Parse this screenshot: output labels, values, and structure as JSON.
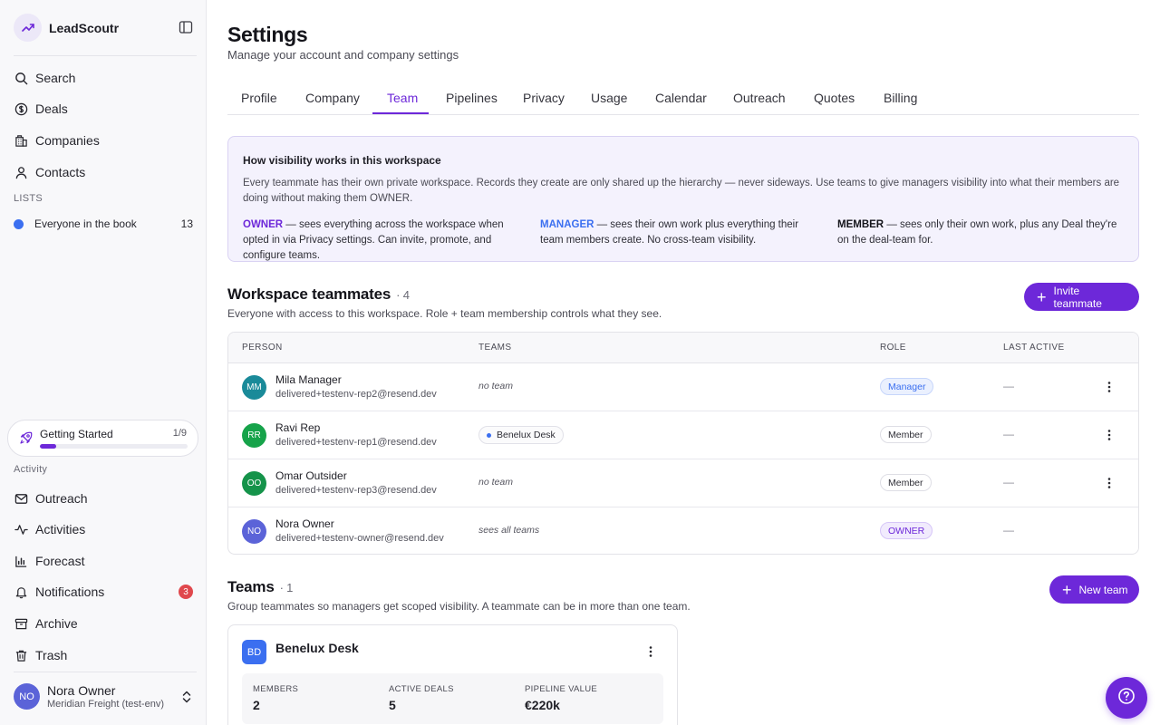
{
  "sidebar": {
    "brand": "LeadScoutr",
    "nav": [
      {
        "label": "Search",
        "icon": "search-icon"
      },
      {
        "label": "Deals",
        "icon": "dollar-icon"
      },
      {
        "label": "Companies",
        "icon": "building-icon"
      },
      {
        "label": "Contacts",
        "icon": "user-icon"
      }
    ],
    "lists_label": "LISTS",
    "lists": [
      {
        "label": "Everyone in the book",
        "count": "13",
        "color": "#3b6ff0"
      }
    ],
    "getting_started": {
      "label": "Getting Started",
      "progress_text": "1/9",
      "progress": 0.11
    },
    "activity_label": "Activity",
    "activity": [
      {
        "label": "Outreach",
        "icon": "mail-icon"
      },
      {
        "label": "Activities",
        "icon": "activity-icon"
      },
      {
        "label": "Forecast",
        "icon": "bar-chart-icon"
      },
      {
        "label": "Notifications",
        "icon": "bell-icon",
        "badge": "3"
      },
      {
        "label": "Archive",
        "icon": "archive-icon"
      },
      {
        "label": "Trash",
        "icon": "trash-icon"
      }
    ],
    "user": {
      "initials": "NO",
      "name": "Nora Owner",
      "org": "Meridian Freight (test-env)"
    }
  },
  "header": {
    "title": "Settings",
    "subtitle": "Manage your account and company settings"
  },
  "tabs": [
    "Profile",
    "Company",
    "Team",
    "Pipelines",
    "Privacy",
    "Usage",
    "Calendar",
    "Outreach",
    "Quotes",
    "Billing"
  ],
  "active_tab": "Team",
  "info": {
    "title": "How visibility works in this workspace",
    "body": "Every teammate has their own private workspace. Records they create are only shared up the hierarchy — never sideways. Use teams to give managers visibility into what their members are doing without making them OWNER.",
    "roles": [
      {
        "key": "OWNER",
        "text": " — sees everything across the workspace when opted in via Privacy settings. Can invite, promote, and configure teams."
      },
      {
        "key": "MANAGER",
        "text": " — sees their own work plus everything their team members create. No cross-team visibility."
      },
      {
        "key": "MEMBER",
        "text": " — sees only their own work, plus any Deal they're on the deal-team for."
      }
    ]
  },
  "teammates": {
    "title": "Workspace teammates",
    "count": "· 4",
    "subtitle": "Everyone with access to this workspace. Role + team membership controls what they see.",
    "invite_label": "Invite teammate",
    "columns": [
      "PERSON",
      "TEAMS",
      "ROLE",
      "LAST ACTIVE"
    ],
    "rows": [
      {
        "initials": "MM",
        "avatar_color": "#1a8a99",
        "name": "Mila Manager",
        "email": "delivered+testenv-rep2@resend.dev",
        "team": "no team",
        "team_type": "none",
        "role": "Manager",
        "role_type": "manager",
        "last_active": "—"
      },
      {
        "initials": "RR",
        "avatar_color": "#16a34a",
        "name": "Ravi Rep",
        "email": "delivered+testenv-rep1@resend.dev",
        "team": "Benelux Desk",
        "team_type": "chip",
        "role": "Member",
        "role_type": "member",
        "last_active": "—"
      },
      {
        "initials": "OO",
        "avatar_color": "#15934a",
        "name": "Omar Outsider",
        "email": "delivered+testenv-rep3@resend.dev",
        "team": "no team",
        "team_type": "none",
        "role": "Member",
        "role_type": "member",
        "last_active": "—"
      },
      {
        "initials": "NO",
        "avatar_color": "#5b63d8",
        "name": "Nora Owner",
        "email": "delivered+testenv-owner@resend.dev",
        "team": "sees all teams",
        "team_type": "none",
        "role": "OWNER",
        "role_type": "owner",
        "last_active": "—"
      }
    ]
  },
  "teams": {
    "title": "Teams",
    "count": "· 1",
    "subtitle": "Group teammates so managers get scoped visibility. A teammate can be in more than one team.",
    "new_label": "New team",
    "cards": [
      {
        "initials": "BD",
        "name": "Benelux Desk",
        "stats": [
          {
            "label": "MEMBERS",
            "value": "2"
          },
          {
            "label": "ACTIVE DEALS",
            "value": "5"
          },
          {
            "label": "PIPELINE VALUE",
            "value": "€220k"
          }
        ]
      }
    ]
  },
  "colors": {
    "accent": "#6d28d9",
    "blue": "#3b6ff0",
    "badge_red": "#e0484d"
  }
}
